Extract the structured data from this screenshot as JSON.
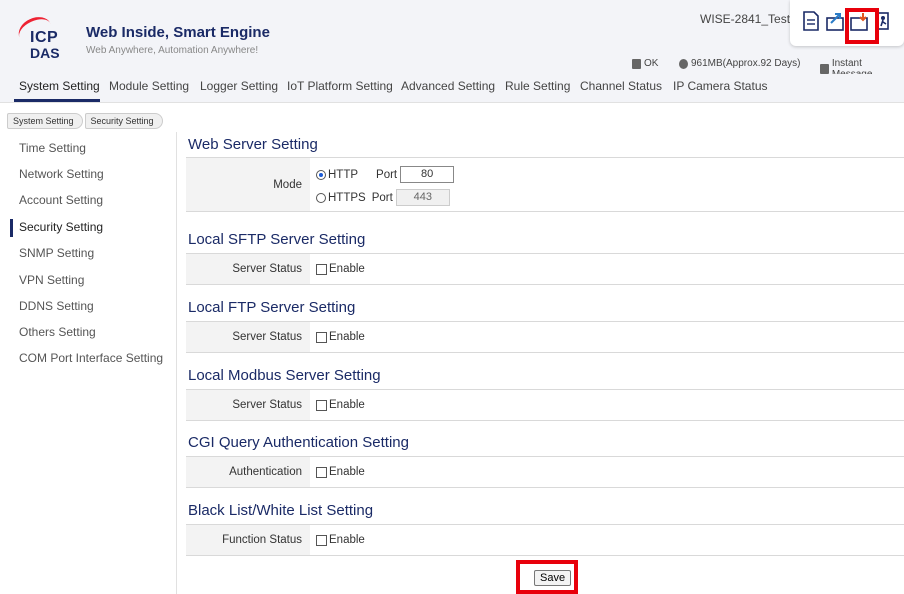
{
  "brand": {
    "logo_top": "ICP",
    "logo_bottom": "DAS",
    "title": "Web Inside, Smart Engine",
    "subtitle": "Web Anywhere, Automation Anywhere!"
  },
  "device_name": "WISE-2841_Test",
  "status": {
    "ok": "OK",
    "storage": "961MB(Approx.92 Days)",
    "message": "Instant Message"
  },
  "nav": [
    "System Setting",
    "Module Setting",
    "Logger Setting",
    "IoT Platform Setting",
    "Advanced Setting",
    "Rule Setting",
    "Channel Status",
    "IP Camera Status"
  ],
  "breadcrumb": [
    "System Setting",
    "Security Setting"
  ],
  "sidebar": [
    "Time Setting",
    "Network Setting",
    "Account Setting",
    "Security Setting",
    "SNMP Setting",
    "VPN Setting",
    "DDNS Setting",
    "Others Setting",
    "COM Port Interface Setting"
  ],
  "web_server": {
    "title": "Web Server Setting",
    "mode_label": "Mode",
    "http_label": "HTTP",
    "https_label": "HTTPS",
    "port_label": "Port",
    "http_port": "80",
    "https_port": "443"
  },
  "sections": [
    {
      "title": "Local SFTP Server Setting",
      "label": "Server Status",
      "option": "Enable"
    },
    {
      "title": "Local FTP Server Setting",
      "label": "Server Status",
      "option": "Enable"
    },
    {
      "title": "Local Modbus Server Setting",
      "label": "Server Status",
      "option": "Enable"
    },
    {
      "title": "CGI Query Authentication Setting",
      "label": "Authentication",
      "option": "Enable"
    },
    {
      "title": "Black List/White List Setting",
      "label": "Function Status",
      "option": "Enable"
    }
  ],
  "save_label": "Save",
  "colors": {
    "accent": "#1a2a66",
    "highlight": "#e8000b"
  }
}
